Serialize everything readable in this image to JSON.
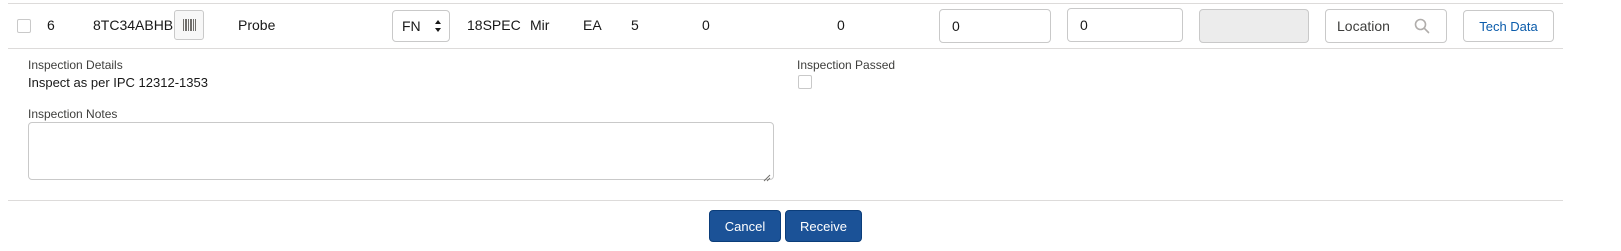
{
  "row": {
    "line_number": "6",
    "part_number": "8TC34ABHB",
    "description": "Probe",
    "condition_select": "FN",
    "code": "18SPEC",
    "vendor": "Mir",
    "uom": "EA",
    "quantity": "5",
    "value_a": "0",
    "value_b": "0",
    "input_1": "0",
    "input_2": "0",
    "location_placeholder": "Location",
    "tech_data_label": "Tech Data"
  },
  "details": {
    "inspection_details_label": "Inspection Details",
    "inspection_details_value": "Inspect as per IPC 12312-1353",
    "inspection_passed_label": "Inspection Passed",
    "inspection_notes_label": "Inspection Notes"
  },
  "footer": {
    "cancel_label": "Cancel",
    "receive_label": "Receive"
  },
  "colors": {
    "brand": "#1b5297",
    "link": "#0b5cab",
    "border": "#c9c9c9"
  }
}
